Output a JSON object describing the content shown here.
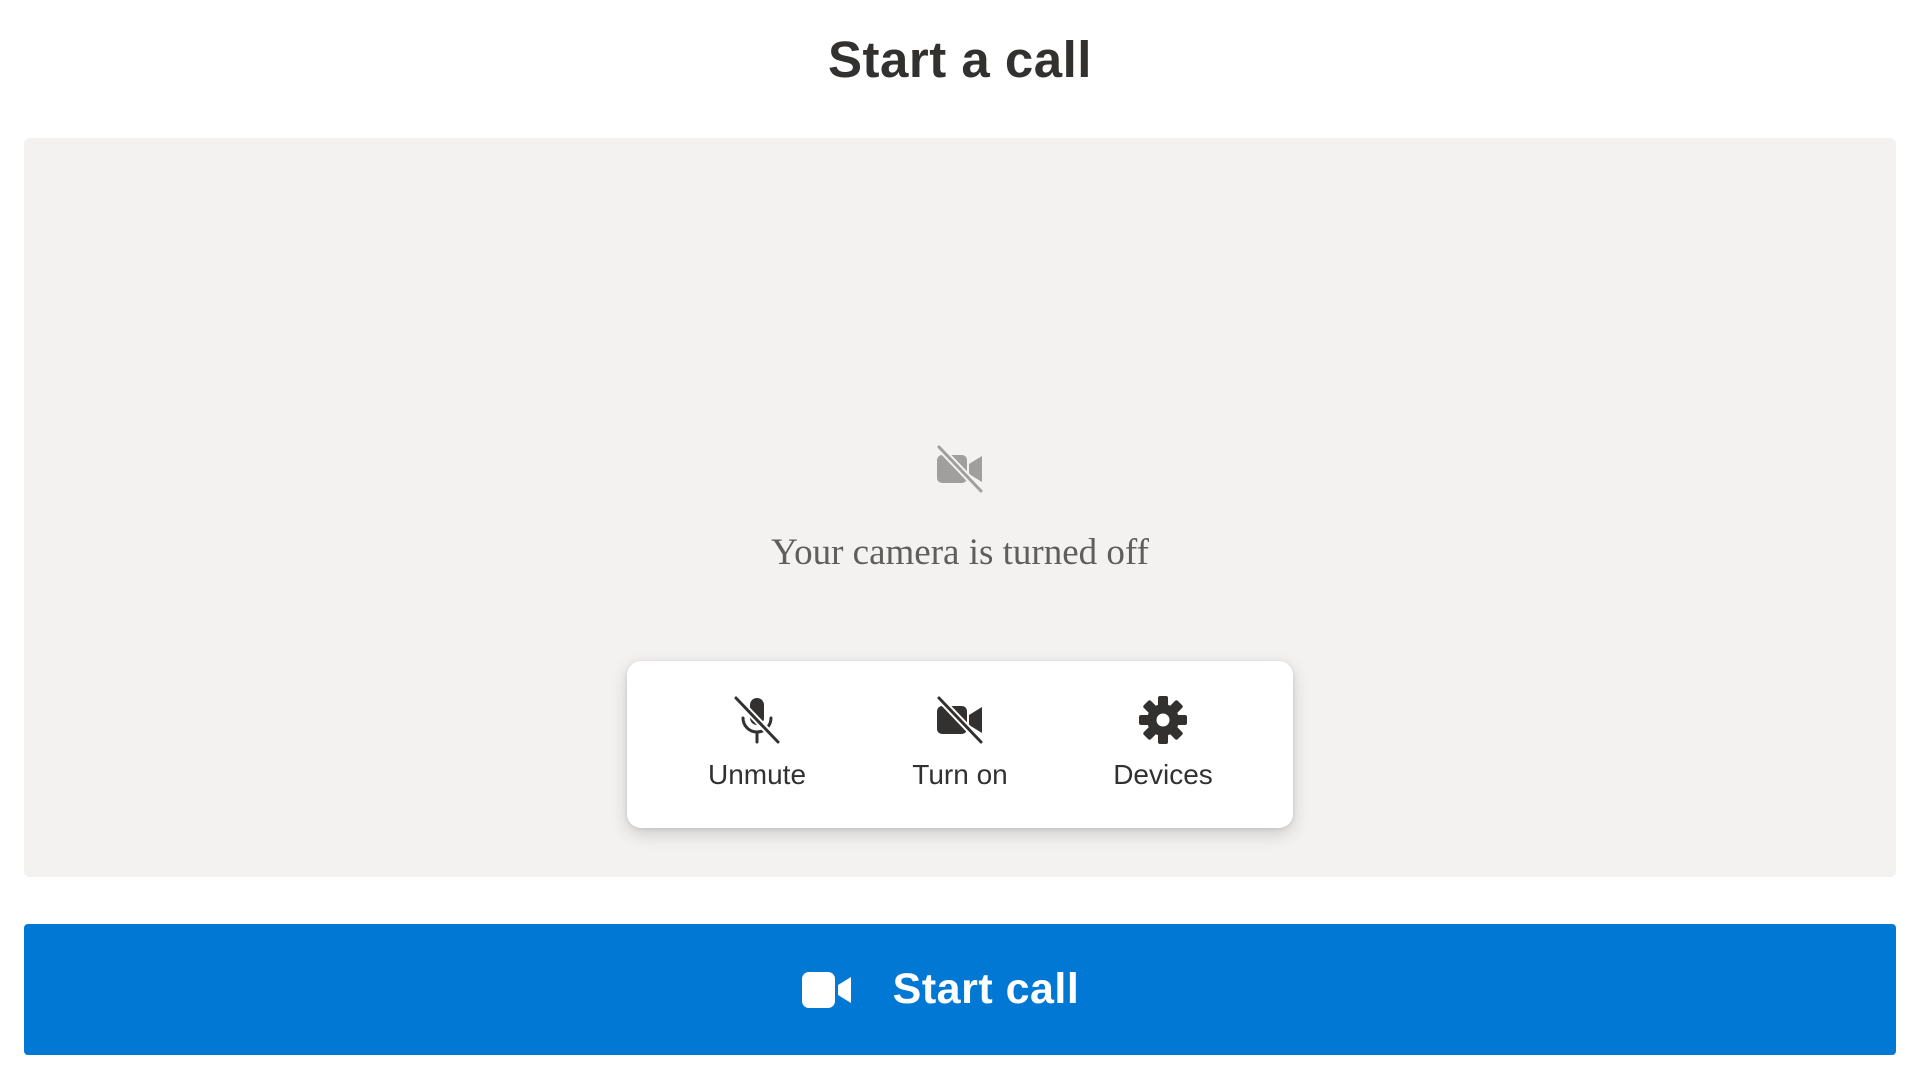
{
  "header": {
    "title": "Start a call"
  },
  "preview": {
    "status_text": "Your camera is turned off",
    "status_icon": "video-off-icon"
  },
  "controls": [
    {
      "label": "Unmute",
      "icon": "mic-off-icon"
    },
    {
      "label": "Turn on",
      "icon": "video-off-icon"
    },
    {
      "label": "Devices",
      "icon": "gear-icon"
    }
  ],
  "footer": {
    "start_call_label": "Start call",
    "start_call_icon": "video-camera-icon"
  },
  "colors": {
    "accent": "#0078d4",
    "preview_background": "#f3f2f1",
    "text_primary": "#323130",
    "text_secondary": "#605e5c",
    "icon_muted": "#a19f9d"
  }
}
